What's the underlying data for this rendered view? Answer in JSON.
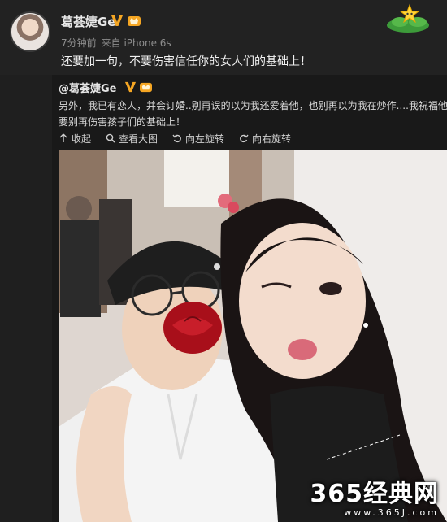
{
  "post": {
    "username": "葛荟婕Ge",
    "time": "7分钟前",
    "source": "来自 iPhone 6s",
    "text": "还要加一句，不要伤害信任你的女人们的基础上！"
  },
  "repost": {
    "username": "@葛荟婕Ge",
    "line1": "另外，我已有恋人，并会订婚..别再误的以为我还爱着他，也别再以为我在炒作....我祝福他，只",
    "line2": "要别再伤害孩子们的基础上！",
    "actions": {
      "collapse": "收起",
      "view_large": "查看大图",
      "rotate_left": "向左旋转",
      "rotate_right": "向右旋转"
    }
  },
  "watermark": {
    "main": "365经典网",
    "url": "www.365J.com"
  },
  "colors": {
    "vip_orange": "#f5a623",
    "background": "#1f1f1f"
  },
  "icons": [
    "verified-v-icon",
    "vip-crown-icon",
    "collapse-arrow-icon",
    "magnifier-icon",
    "rotate-left-icon",
    "rotate-right-icon"
  ]
}
